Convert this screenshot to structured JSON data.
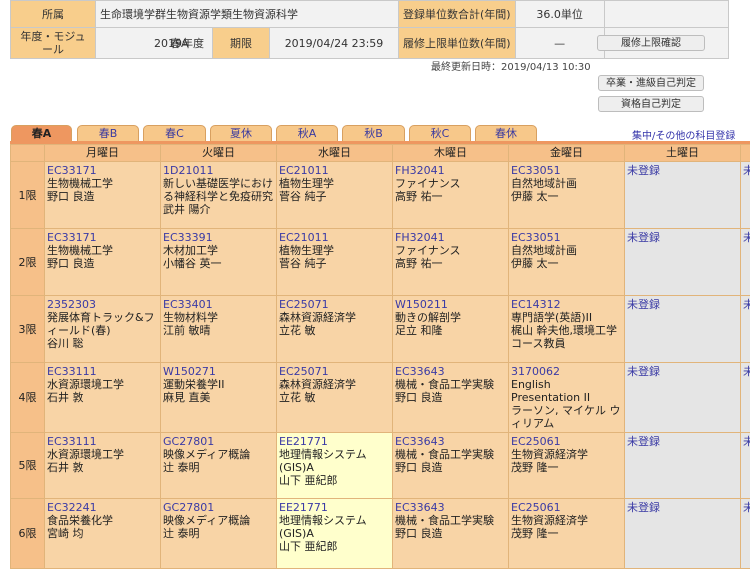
{
  "info": {
    "affiliation_label": "所属",
    "affiliation_value": "生命環境学群生物資源学類生物資源科学",
    "year_module_label": "年度・モジュール",
    "year_value": "2019年度",
    "module_value": "春A",
    "deadline_label": "期限",
    "deadline_value": "2019/04/24 23:59",
    "credit_count_label": "登録単位数合計(年間)",
    "credit_count_value": "36.0単位",
    "credit_limit_label": "履修上限単位数(年間)",
    "credit_limit_value": "—",
    "limit_check_button": "履修上限確認",
    "last_updated": "最終更新日時：2019/04/13 10:30",
    "graduation_button": "卒業・進級自己判定",
    "qualification_button": "資格自己判定"
  },
  "tabs": [
    "春A",
    "春B",
    "春C",
    "夏休",
    "秋A",
    "秋B",
    "秋C",
    "春休"
  ],
  "intensive_link": "集中/その他の科目登録",
  "days": [
    "月曜日",
    "火曜日",
    "水曜日",
    "木曜日",
    "金曜日",
    "土曜日"
  ],
  "periods": [
    "1限",
    "2限",
    "3限",
    "4限",
    "5限",
    "6限"
  ],
  "unregistered": "未登録",
  "schedule": [
    [
      {
        "code": "EC33171",
        "title": "生物機械工学",
        "teacher": "野口 良造"
      },
      {
        "code": "1D21011",
        "title": "新しい基礎医学における神経科学と免疫研究",
        "teacher": "武井 陽介"
      },
      {
        "code": "EC21011",
        "title": "植物生理学",
        "teacher": "菅谷 純子"
      },
      {
        "code": "FH32041",
        "title": "ファイナンス",
        "teacher": "高野 祐一"
      },
      {
        "code": "EC33051",
        "title": "自然地域計画",
        "teacher": "伊藤 太一"
      }
    ],
    [
      {
        "code": "EC33171",
        "title": "生物機械工学",
        "teacher": "野口 良造"
      },
      {
        "code": "EC33391",
        "title": "木材加工学",
        "teacher": "小幡谷 英一"
      },
      {
        "code": "EC21011",
        "title": "植物生理学",
        "teacher": "菅谷 純子"
      },
      {
        "code": "FH32041",
        "title": "ファイナンス",
        "teacher": "高野 祐一"
      },
      {
        "code": "EC33051",
        "title": "自然地域計画",
        "teacher": "伊藤 太一"
      }
    ],
    [
      {
        "code": "2352303",
        "title": "発展体育トラック&フィールド(春)",
        "teacher": "谷川 聡"
      },
      {
        "code": "EC33401",
        "title": "生物材料学",
        "teacher": "江前 敏晴"
      },
      {
        "code": "EC25071",
        "title": "森林資源経済学",
        "teacher": "立花 敏"
      },
      {
        "code": "W150211",
        "title": "動きの解剖学",
        "teacher": "足立 和隆"
      },
      {
        "code": "EC14312",
        "title": "専門語学(英語)II",
        "teacher": "梶山 幹夫他,環境工学コース教員"
      }
    ],
    [
      {
        "code": "EC33111",
        "title": "水資源環境工学",
        "teacher": "石井 敦"
      },
      {
        "code": "W150271",
        "title": "運動栄養学II",
        "teacher": "麻見 直美"
      },
      {
        "code": "EC25071",
        "title": "森林資源経済学",
        "teacher": "立花 敏"
      },
      {
        "code": "EC33643",
        "title": "機械・食品工学実験",
        "teacher": "野口 良造"
      },
      {
        "code": "3170062",
        "title": "English Presentation II",
        "teacher": "ラーソン, マイケル ウィリアム"
      }
    ],
    [
      {
        "code": "EC33111",
        "title": "水資源環境工学",
        "teacher": "石井 敦"
      },
      {
        "code": "GC27801",
        "title": "映像メディア概論",
        "teacher": "辻 泰明"
      },
      {
        "code": "EE21771",
        "title": "地理情報システム(GIS)A",
        "teacher": "山下 亜紀郎",
        "hl": true
      },
      {
        "code": "EC33643",
        "title": "機械・食品工学実験",
        "teacher": "野口 良造"
      },
      {
        "code": "EC25061",
        "title": "生物資源経済学",
        "teacher": "茂野 隆一"
      }
    ],
    [
      {
        "code": "EC32241",
        "title": "食品栄養化学",
        "teacher": "宮崎 均"
      },
      {
        "code": "GC27801",
        "title": "映像メディア概論",
        "teacher": "辻 泰明"
      },
      {
        "code": "EE21771",
        "title": "地理情報システム(GIS)A",
        "teacher": "山下 亜紀郎",
        "hl": true
      },
      {
        "code": "EC33643",
        "title": "機械・食品工学実験",
        "teacher": "野口 良造"
      },
      {
        "code": "EC25061",
        "title": "生物資源経済学",
        "teacher": "茂野 隆一"
      }
    ]
  ],
  "sunday_cut_text": "未"
}
